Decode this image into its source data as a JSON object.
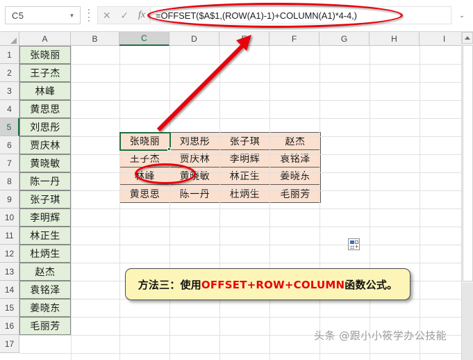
{
  "formula_bar": {
    "name_box_value": "C5",
    "cancel_icon": "close-icon",
    "confirm_icon": "check-icon",
    "function_icon": "fx-icon",
    "formula": "=OFFSET($A$1,(ROW(A1)-1)+COLUMN(A1)*4-4,)",
    "expand_icon": "chevron-down-icon",
    "caret_icon": "chevron-down-icon"
  },
  "sheet": {
    "column_headers": [
      "A",
      "B",
      "C",
      "D",
      "E",
      "F",
      "G",
      "H",
      "I"
    ],
    "active_column": "C",
    "row_headers": [
      "1",
      "2",
      "3",
      "4",
      "5",
      "6",
      "7",
      "8",
      "9",
      "10",
      "11",
      "12",
      "13",
      "14",
      "15",
      "16",
      "17"
    ],
    "active_row": "5",
    "source_column_values": [
      "张晓丽",
      "王子杰",
      "林峰",
      "黄思思",
      "刘思彤",
      "贾庆林",
      "黄晓敏",
      "陈一丹",
      "张子琪",
      "李明辉",
      "林正生",
      "杜炳生",
      "赵杰",
      "袁铭泽",
      "姜晓东",
      "毛丽芳"
    ],
    "result_grid": [
      [
        "张晓丽",
        "刘思彤",
        "张子琪",
        "赵杰"
      ],
      [
        "王子杰",
        "贾庆林",
        "李明辉",
        "袁铭泽"
      ],
      [
        "林峰",
        "黄晓敏",
        "林正生",
        "姜晓东"
      ],
      [
        "黄思思",
        "陈一丹",
        "杜炳生",
        "毛丽芳"
      ]
    ],
    "selected_cell_text": "张晓丽",
    "autofill_button_name": "auto-fill-options"
  },
  "callout": {
    "prefix": "方法三：使用",
    "highlight": "OFFSET+ROW+COLUMN",
    "suffix": "函数公式。"
  },
  "watermark": {
    "text": "头条 @跟小小筱学办公技能"
  },
  "colors": {
    "source_cell_fill": "#e2efda",
    "result_cell_fill": "#fbe0cf",
    "callout_fill": "#fdf5b7",
    "annotation_red": "#e8000b",
    "excel_green": "#1d6f42"
  }
}
